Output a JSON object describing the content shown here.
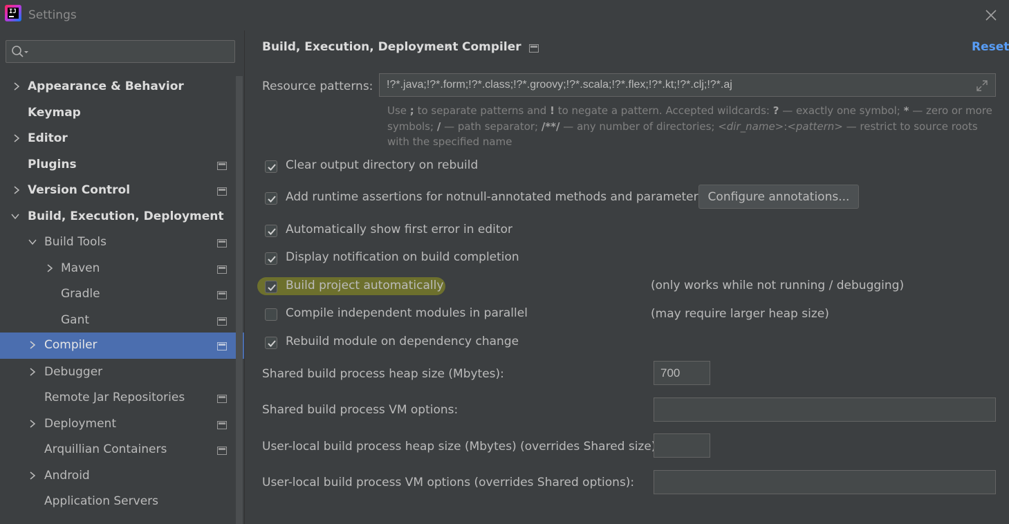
{
  "window": {
    "title": "Settings"
  },
  "search": {
    "placeholder": ""
  },
  "sidebar": {
    "items": [
      {
        "label": "Appearance & Behavior"
      },
      {
        "label": "Keymap"
      },
      {
        "label": "Editor"
      },
      {
        "label": "Plugins"
      },
      {
        "label": "Version Control"
      },
      {
        "label": "Build, Execution, Deployment"
      },
      {
        "label": "Build Tools"
      },
      {
        "label": "Maven"
      },
      {
        "label": "Gradle"
      },
      {
        "label": "Gant"
      },
      {
        "label": "Compiler"
      },
      {
        "label": "Debugger"
      },
      {
        "label": "Remote Jar Repositories"
      },
      {
        "label": "Deployment"
      },
      {
        "label": "Arquillian Containers"
      },
      {
        "label": "Android"
      },
      {
        "label": "Application Servers"
      }
    ]
  },
  "header": {
    "breadcrumb": [
      "Build, Execution, Deployment",
      "Compiler"
    ],
    "separator": "›",
    "reset_label": "Reset"
  },
  "resource": {
    "label": "Resource patterns:",
    "value": "!?*.java;!?*.form;!?*.class;!?*.groovy;!?*.scala;!?*.flex;!?*.kt;!?*.clj;!?*.aj",
    "help": {
      "t1": "Use ",
      "b1": ";",
      "t2": " to separate patterns and ",
      "b2": "!",
      "t3": " to negate a pattern. Accepted wildcards: ",
      "b3": "?",
      "t4": " — exactly one symbol; ",
      "b4": "*",
      "t5": " — zero or more symbols; ",
      "b5": "/",
      "t6": " — path separator; ",
      "b6": "/**/",
      "t7": " — any number of directories; ",
      "i1": "<dir_name>",
      "t8": ":",
      "i2": "<pattern>",
      "t9": " — restrict to source roots with the specified name"
    }
  },
  "options": [
    {
      "label": "Clear output directory on rebuild",
      "checked": true
    },
    {
      "label": "Add runtime assertions for notnull-annotated methods and parameters",
      "checked": true
    },
    {
      "label": "Automatically show first error in editor",
      "checked": true
    },
    {
      "label": "Display notification on build completion",
      "checked": true
    },
    {
      "label": "Build project automatically",
      "checked": true,
      "note": "(only works while not running / debugging)"
    },
    {
      "label": "Compile independent modules in parallel",
      "checked": false,
      "note": "(may require larger heap size)"
    },
    {
      "label": "Rebuild module on dependency change",
      "checked": true
    }
  ],
  "configure_button": "Configure annotations...",
  "fields": [
    {
      "label": "Shared build process heap size (Mbytes):",
      "value": "700"
    },
    {
      "label": "Shared build process VM options:",
      "value": ""
    },
    {
      "label": "User-local build process heap size (Mbytes) (overrides Shared size):",
      "value": ""
    },
    {
      "label": "User-local build process VM options (overrides Shared options):",
      "value": ""
    }
  ],
  "colors": {
    "background": "#3c3f41",
    "selection": "#4b6eaf",
    "link": "#589df6",
    "highlight": "#e1e100"
  },
  "icons": {
    "close": "close-icon",
    "search": "search-icon",
    "expand": "expand-icon",
    "chevron_right": "chevron-right-icon",
    "chevron_down": "chevron-down-icon",
    "page": "project-level-icon"
  }
}
